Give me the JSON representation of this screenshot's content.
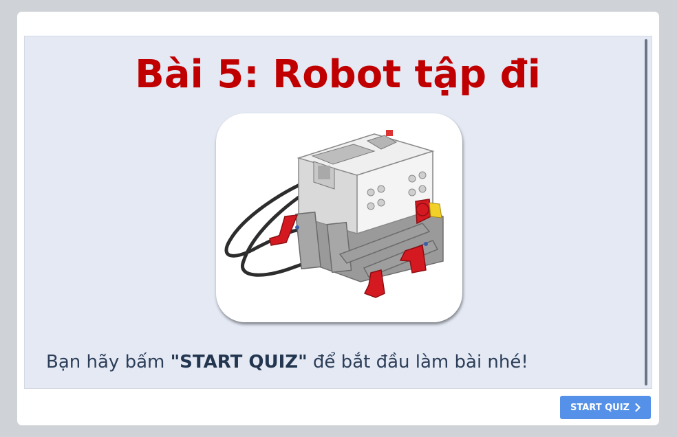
{
  "slide": {
    "title": "Bài 5: Robot tập đi",
    "image_icon": "lego-ev3-walking-robot",
    "instruction_prefix": "Bạn hãy bấm ",
    "instruction_bold": "\"START QUIZ\"",
    "instruction_suffix": " để bắt đầu làm bài nhé!"
  },
  "footer": {
    "start_button_label": "START QUIZ",
    "start_button_icon": "chevron-right-icon"
  },
  "colors": {
    "title": "#c00000",
    "slide_background": "#e4e9f4",
    "button": "#5591e8",
    "page_background": "#cfd3d7"
  }
}
